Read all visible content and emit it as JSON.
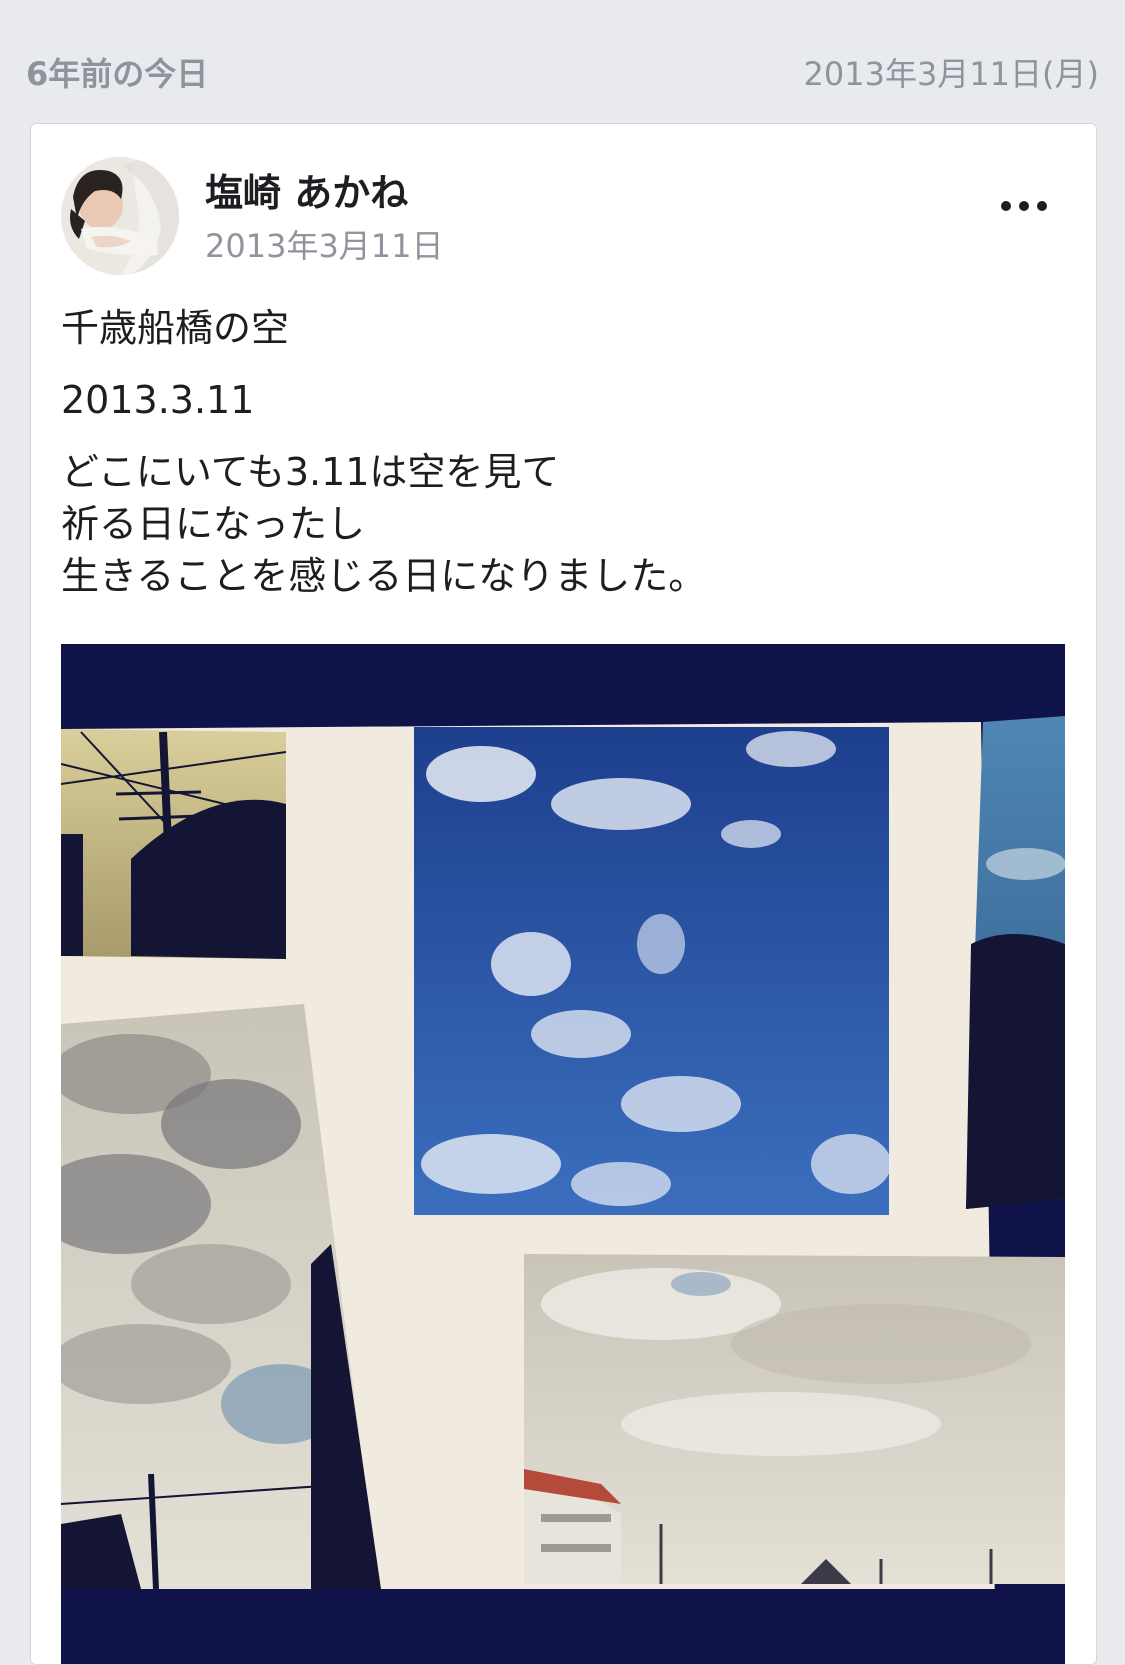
{
  "memory": {
    "label": "6年前の今日",
    "date": "2013年3月11日(月)"
  },
  "post": {
    "author": "塩崎 あかね",
    "date": "2013年3月11日",
    "more_icon": "more-horizontal-icon",
    "text": {
      "line1": "千歳船橋の空",
      "line2": "2013.3.11",
      "line3a": "どこにいても3.11は空を見て",
      "line3b": "祈る日になったし",
      "line3c": "生きることを感じる日になりました。"
    }
  },
  "colors": {
    "background": "#e9eaee",
    "card": "#ffffff",
    "secondary_text": "#8d949e",
    "primary_text": "#1c1e21",
    "photo_navy": "#10134a"
  }
}
